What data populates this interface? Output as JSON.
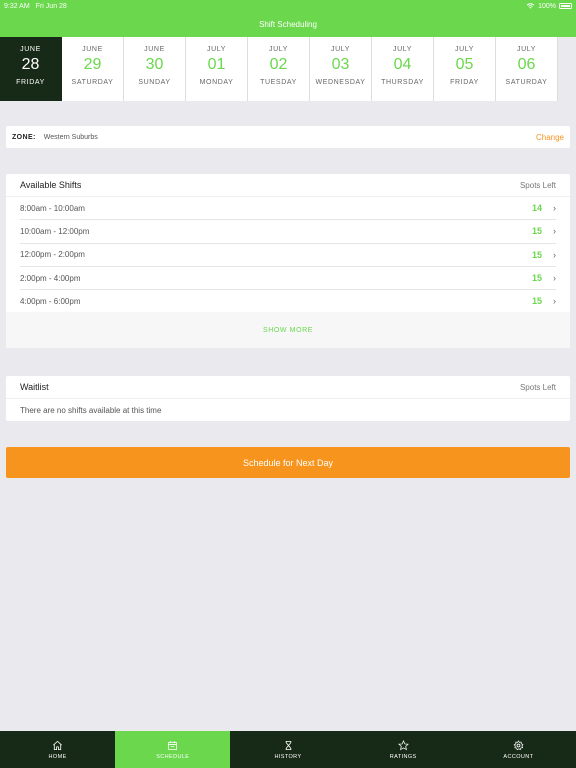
{
  "status_bar": {
    "time": "9:32 AM",
    "date": "Fri Jun 28",
    "battery": "100%"
  },
  "nav": {
    "title": "Shift Scheduling"
  },
  "dates": [
    {
      "month": "JUNE",
      "day": "28",
      "weekday": "FRIDAY",
      "selected": true
    },
    {
      "month": "JUNE",
      "day": "29",
      "weekday": "SATURDAY"
    },
    {
      "month": "JUNE",
      "day": "30",
      "weekday": "SUNDAY"
    },
    {
      "month": "JULY",
      "day": "01",
      "weekday": "MONDAY"
    },
    {
      "month": "JULY",
      "day": "02",
      "weekday": "TUESDAY"
    },
    {
      "month": "JULY",
      "day": "03",
      "weekday": "WEDNESDAY"
    },
    {
      "month": "JULY",
      "day": "04",
      "weekday": "THURSDAY"
    },
    {
      "month": "JULY",
      "day": "05",
      "weekday": "FRIDAY"
    },
    {
      "month": "JULY",
      "day": "06",
      "weekday": "SATURDAY"
    }
  ],
  "zone": {
    "label": "ZONE:",
    "value": "Western Suburbs",
    "change_label": "Change"
  },
  "available_shifts": {
    "title": "Available Shifts",
    "spots_header": "Spots Left",
    "rows": [
      {
        "time": "8:00am - 10:00am",
        "spots": "14"
      },
      {
        "time": "10:00am - 12:00pm",
        "spots": "15"
      },
      {
        "time": "12:00pm - 2:00pm",
        "spots": "15"
      },
      {
        "time": "2:00pm - 4:00pm",
        "spots": "15"
      },
      {
        "time": "4:00pm - 6:00pm",
        "spots": "15"
      }
    ],
    "show_more": "SHOW MORE"
  },
  "waitlist": {
    "title": "Waitlist",
    "spots_header": "Spots Left",
    "empty_message": "There are no shifts available at this time"
  },
  "schedule_button": {
    "label": "Schedule for Next Day"
  },
  "tabs": [
    {
      "label": "HOME",
      "icon": "home-icon"
    },
    {
      "label": "SCHEDULE",
      "icon": "calendar-icon",
      "active": true
    },
    {
      "label": "HISTORY",
      "icon": "hourglass-icon"
    },
    {
      "label": "RATINGS",
      "icon": "star-icon"
    },
    {
      "label": "ACCOUNT",
      "icon": "gear-icon"
    }
  ],
  "colors": {
    "brand_green": "#6ad74c",
    "dark_green": "#172a17",
    "accent_orange": "#f7941d",
    "background": "#e9e9ee"
  }
}
